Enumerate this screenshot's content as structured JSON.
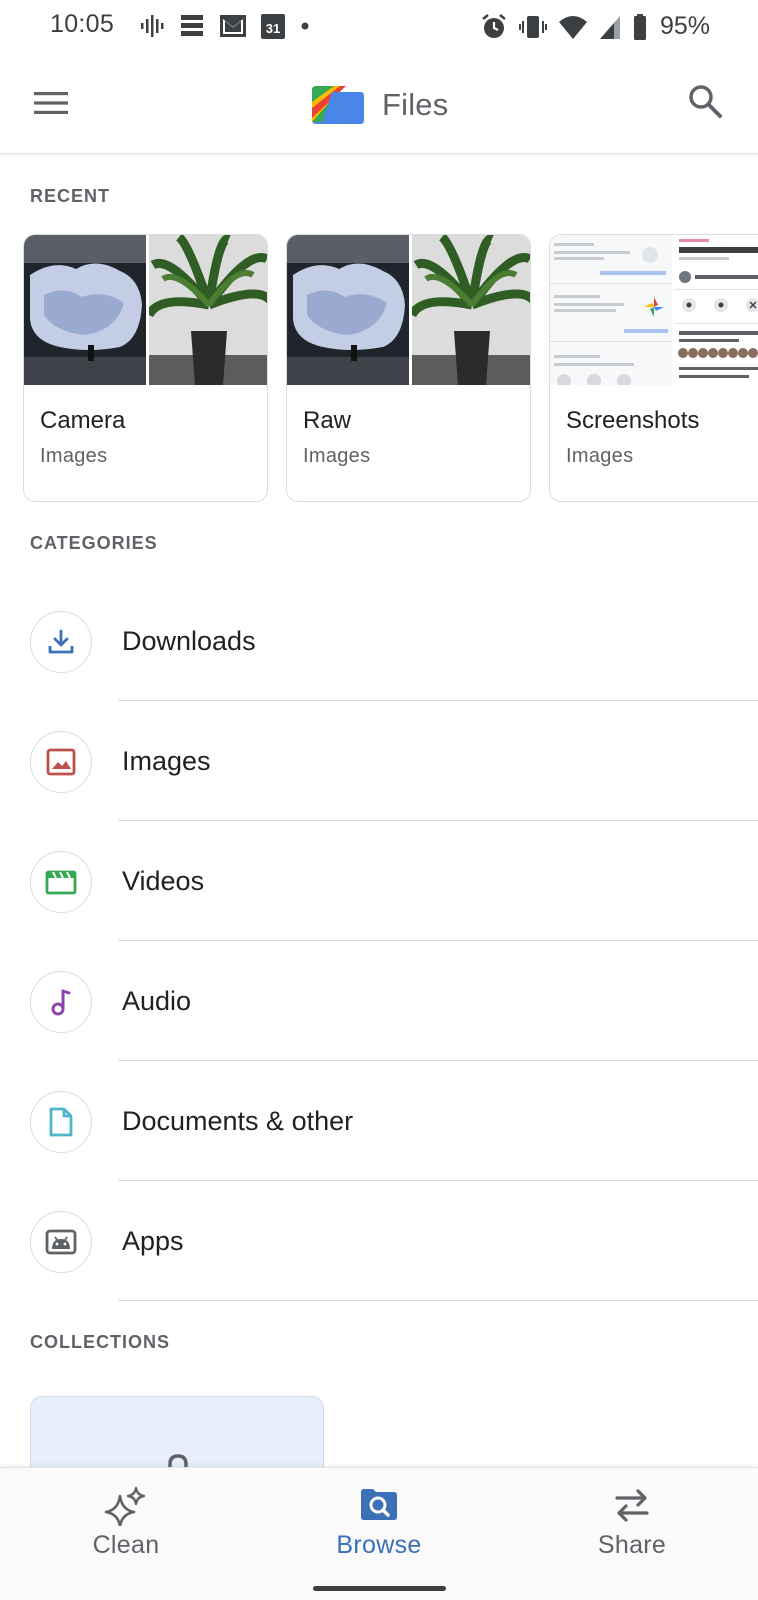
{
  "status_bar": {
    "time": "10:05",
    "battery": "95%",
    "calendar_day": "31",
    "left_icons": [
      "podcast-icon",
      "news-icon",
      "gmail-icon",
      "calendar-icon",
      "dot-icon"
    ],
    "right_icons": [
      "alarm-icon",
      "vibrate-icon",
      "wifi-icon",
      "signal-icon",
      "battery-icon"
    ]
  },
  "app_bar": {
    "title": "Files",
    "menu_icon": "hamburger-menu-icon",
    "search_icon": "search-icon",
    "logo": "files-logo-icon"
  },
  "recent": {
    "header": "RECENT",
    "cards": [
      {
        "title": "Camera",
        "subtitle": "Images"
      },
      {
        "title": "Raw",
        "subtitle": "Images"
      },
      {
        "title": "Screenshots",
        "subtitle": "Images"
      }
    ]
  },
  "categories": {
    "header": "CATEGORIES",
    "items": [
      {
        "label": "Downloads",
        "icon": "download-icon",
        "color": "#3b6fb6"
      },
      {
        "label": "Images",
        "icon": "image-icon",
        "color": "#c0504d"
      },
      {
        "label": "Videos",
        "icon": "video-icon",
        "color": "#34a853"
      },
      {
        "label": "Audio",
        "icon": "audio-icon",
        "color": "#8e44ad"
      },
      {
        "label": "Documents & other",
        "icon": "document-icon",
        "color": "#4db6c8"
      },
      {
        "label": "Apps",
        "icon": "android-icon",
        "color": "#5f6368"
      }
    ]
  },
  "collections": {
    "header": "COLLECTIONS",
    "card_icon": "lock-icon"
  },
  "bottom_nav": {
    "items": [
      {
        "label": "Clean",
        "icon": "sparkle-icon",
        "active": false
      },
      {
        "label": "Browse",
        "icon": "browse-icon",
        "active": true
      },
      {
        "label": "Share",
        "icon": "swap-arrows-icon",
        "active": false
      }
    ]
  },
  "colors": {
    "accent": "#3b6fb6",
    "text_primary": "#202124",
    "text_secondary": "#5f6368",
    "divider": "#dadce0"
  }
}
